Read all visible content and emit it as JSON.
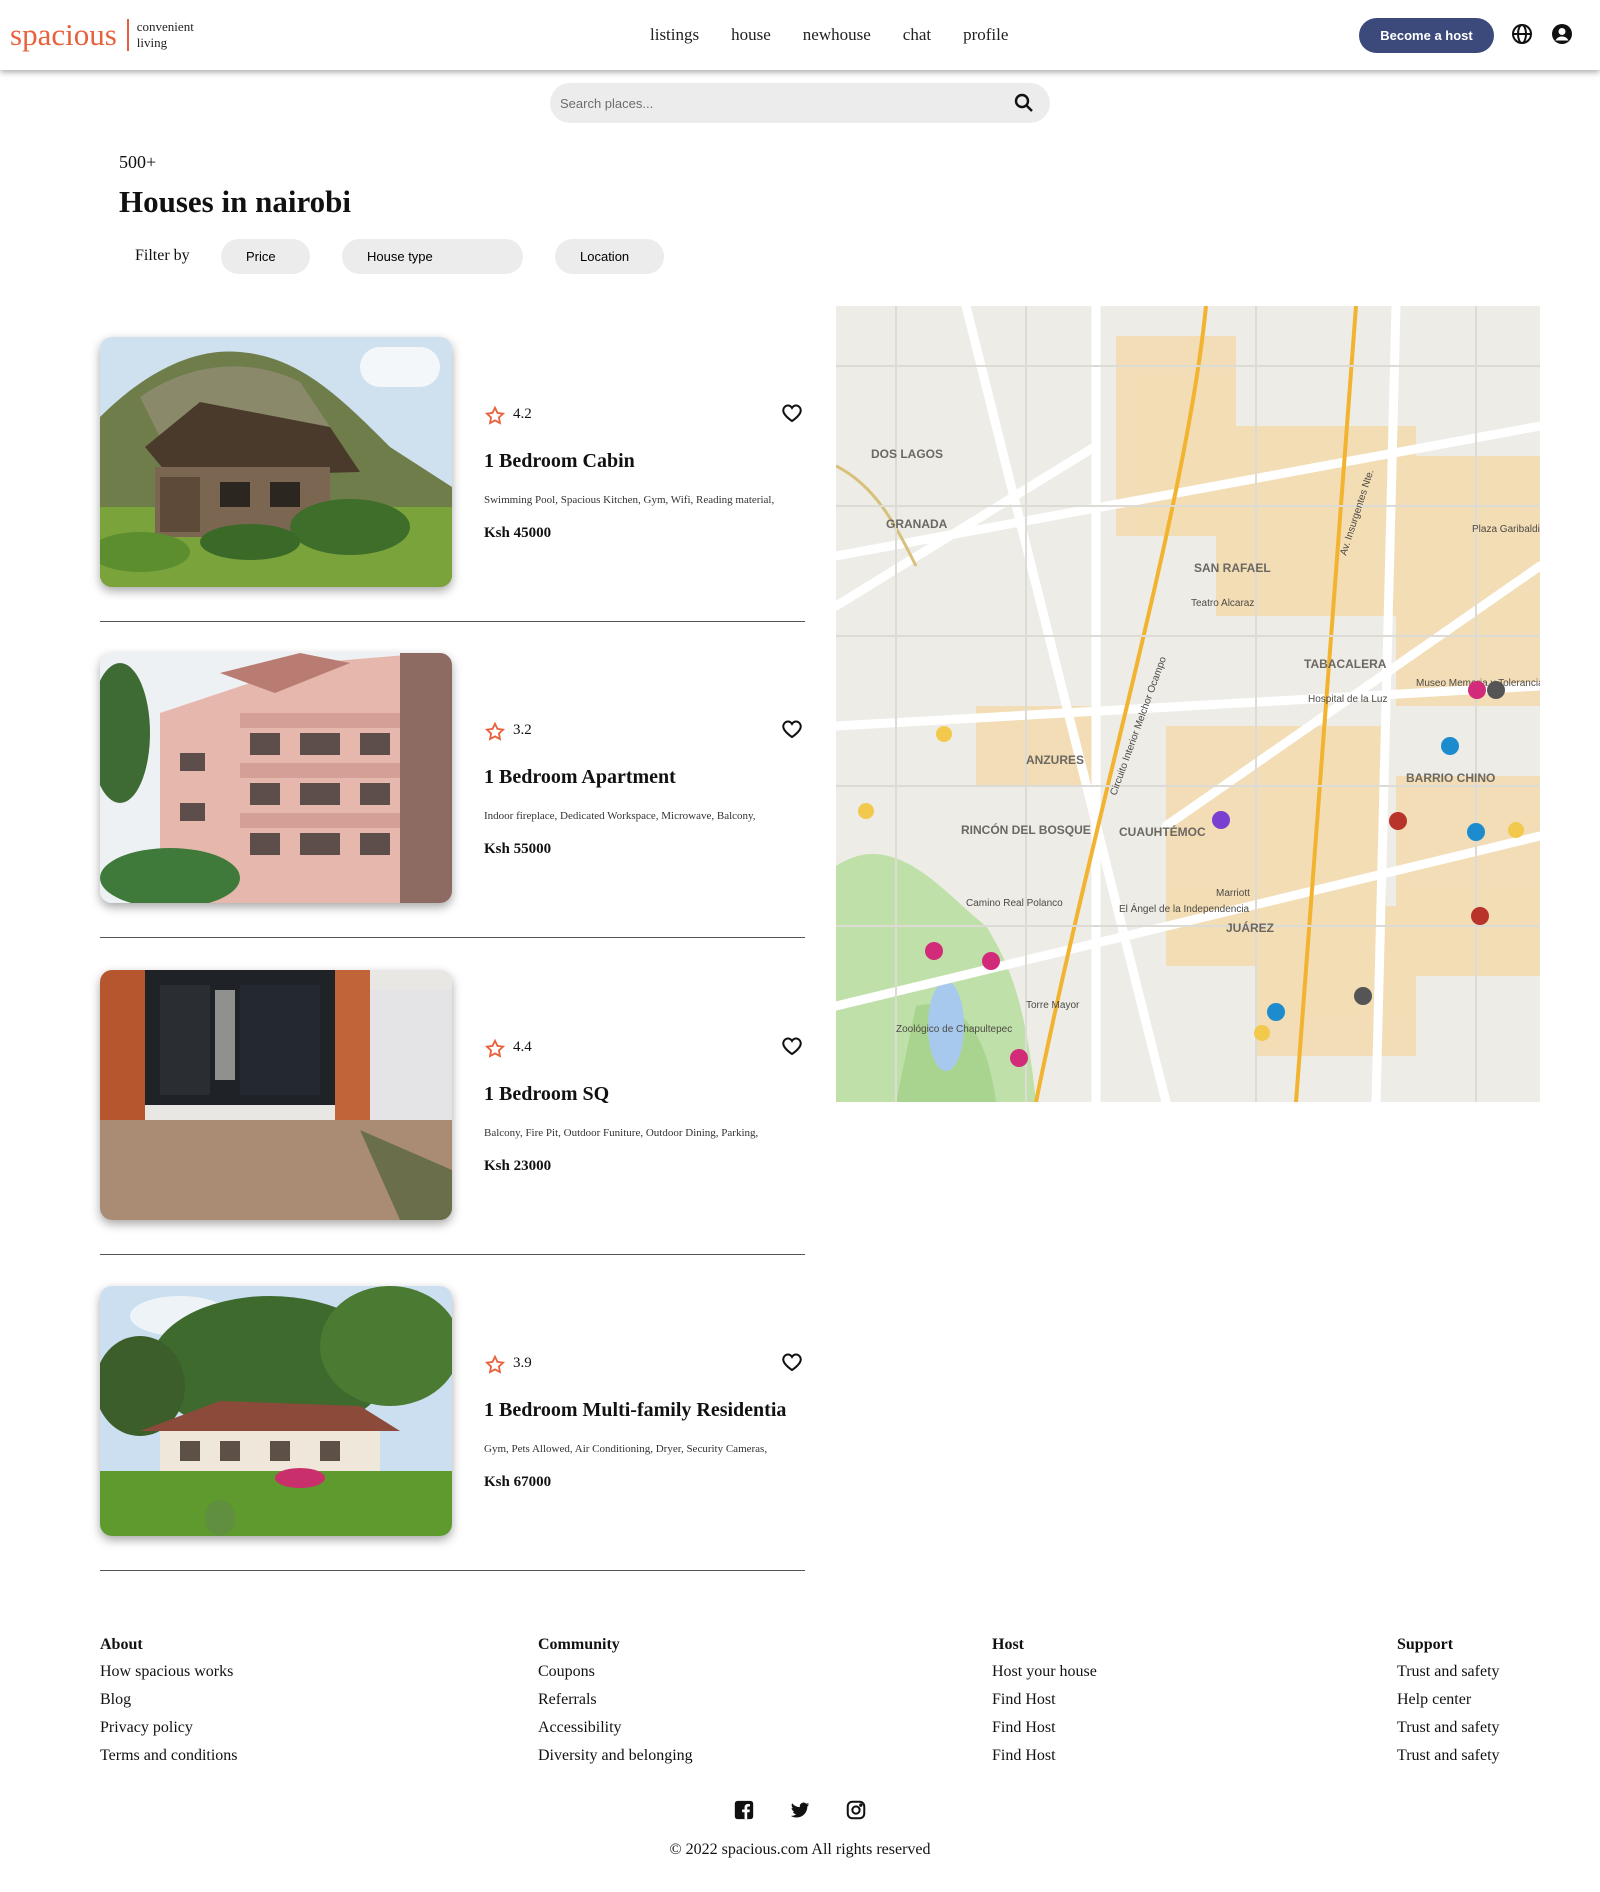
{
  "brand": {
    "name": "spacious",
    "tagline_1": "convenient",
    "tagline_2": "living",
    "accent": "#e8613c",
    "button_color": "#3b4a7a"
  },
  "nav": {
    "items": [
      "listings",
      "house",
      "newhouse",
      "chat",
      "profile"
    ]
  },
  "header": {
    "host_button": "Become a host",
    "icons": [
      "globe-icon",
      "user-circle-icon"
    ]
  },
  "search": {
    "placeholder": "Search places...",
    "value": ""
  },
  "results": {
    "count": "500+",
    "title": "Houses in nairobi"
  },
  "filters": {
    "label": "Filter by",
    "chips": [
      "Price",
      "House type",
      "Location"
    ]
  },
  "listings": [
    {
      "rating": "4.2",
      "name": "1 Bedroom Cabin",
      "amenities": "Swimming Pool, Spacious Kitchen, Gym, Wifi, Reading material,",
      "price": "Ksh 45000",
      "photo": "log cabin on hillside"
    },
    {
      "rating": "3.2",
      "name": "1 Bedroom Apartment",
      "amenities": "Indoor fireplace, Dedicated Workspace, Microwave, Balcony,",
      "price": "Ksh 55000",
      "photo": "pink apartment block"
    },
    {
      "rating": "4.4",
      "name": "1 Bedroom SQ",
      "amenities": "Balcony, Fire Pit, Outdoor Funiture, Outdoor Dining, Parking,",
      "price": "Ksh 23000",
      "photo": "black gate with brick pillars"
    },
    {
      "rating": "3.9",
      "name": "1 Bedroom Multi-family Residentia",
      "amenities": "Gym, Pets Allowed, Air Conditioning, Dryer, Security Cameras,",
      "price": "Ksh 67000",
      "photo": "house with garden and trees"
    }
  ],
  "map": {
    "labels": [
      "DOS LAGOS",
      "GRANADA",
      "SAN RAFAEL",
      "TABACALERA",
      "ANZURES",
      "RINCÓN DEL BOSQUE",
      "CUAUHTÉMOC",
      "JUÁREZ",
      "BARRIO CHINO",
      "Av. Insurgentes Nte.",
      "Circuito Interior Melchor Ocampo",
      "Zoológico de Chapultepec",
      "Torre Mayor",
      "Hospital de la Luz",
      "Museo Memoria y Tolerancia",
      "Plaza Garibaldi",
      "Marriott",
      "Teatro Alcaraz",
      "Camino Real Polanco",
      "El Ángel de la Independencia"
    ]
  },
  "footer": {
    "columns": [
      {
        "heading": "About",
        "links": [
          "How spacious works",
          "Blog",
          "Privacy policy",
          "Terms and conditions"
        ]
      },
      {
        "heading": "Community",
        "links": [
          "Coupons",
          "Referrals",
          "Accessibility",
          "Diversity and belonging"
        ]
      },
      {
        "heading": "Host",
        "links": [
          "Host your house",
          "Find Host",
          "Find Host",
          "Find Host"
        ]
      },
      {
        "heading": "Support",
        "links": [
          "Trust and safety",
          "Help center",
          "Trust and safety",
          "Trust and safety"
        ]
      }
    ],
    "social": [
      "facebook-icon",
      "twitter-icon",
      "instagram-icon"
    ],
    "copyright": "© 2022 spacious.com All rights reserved"
  }
}
